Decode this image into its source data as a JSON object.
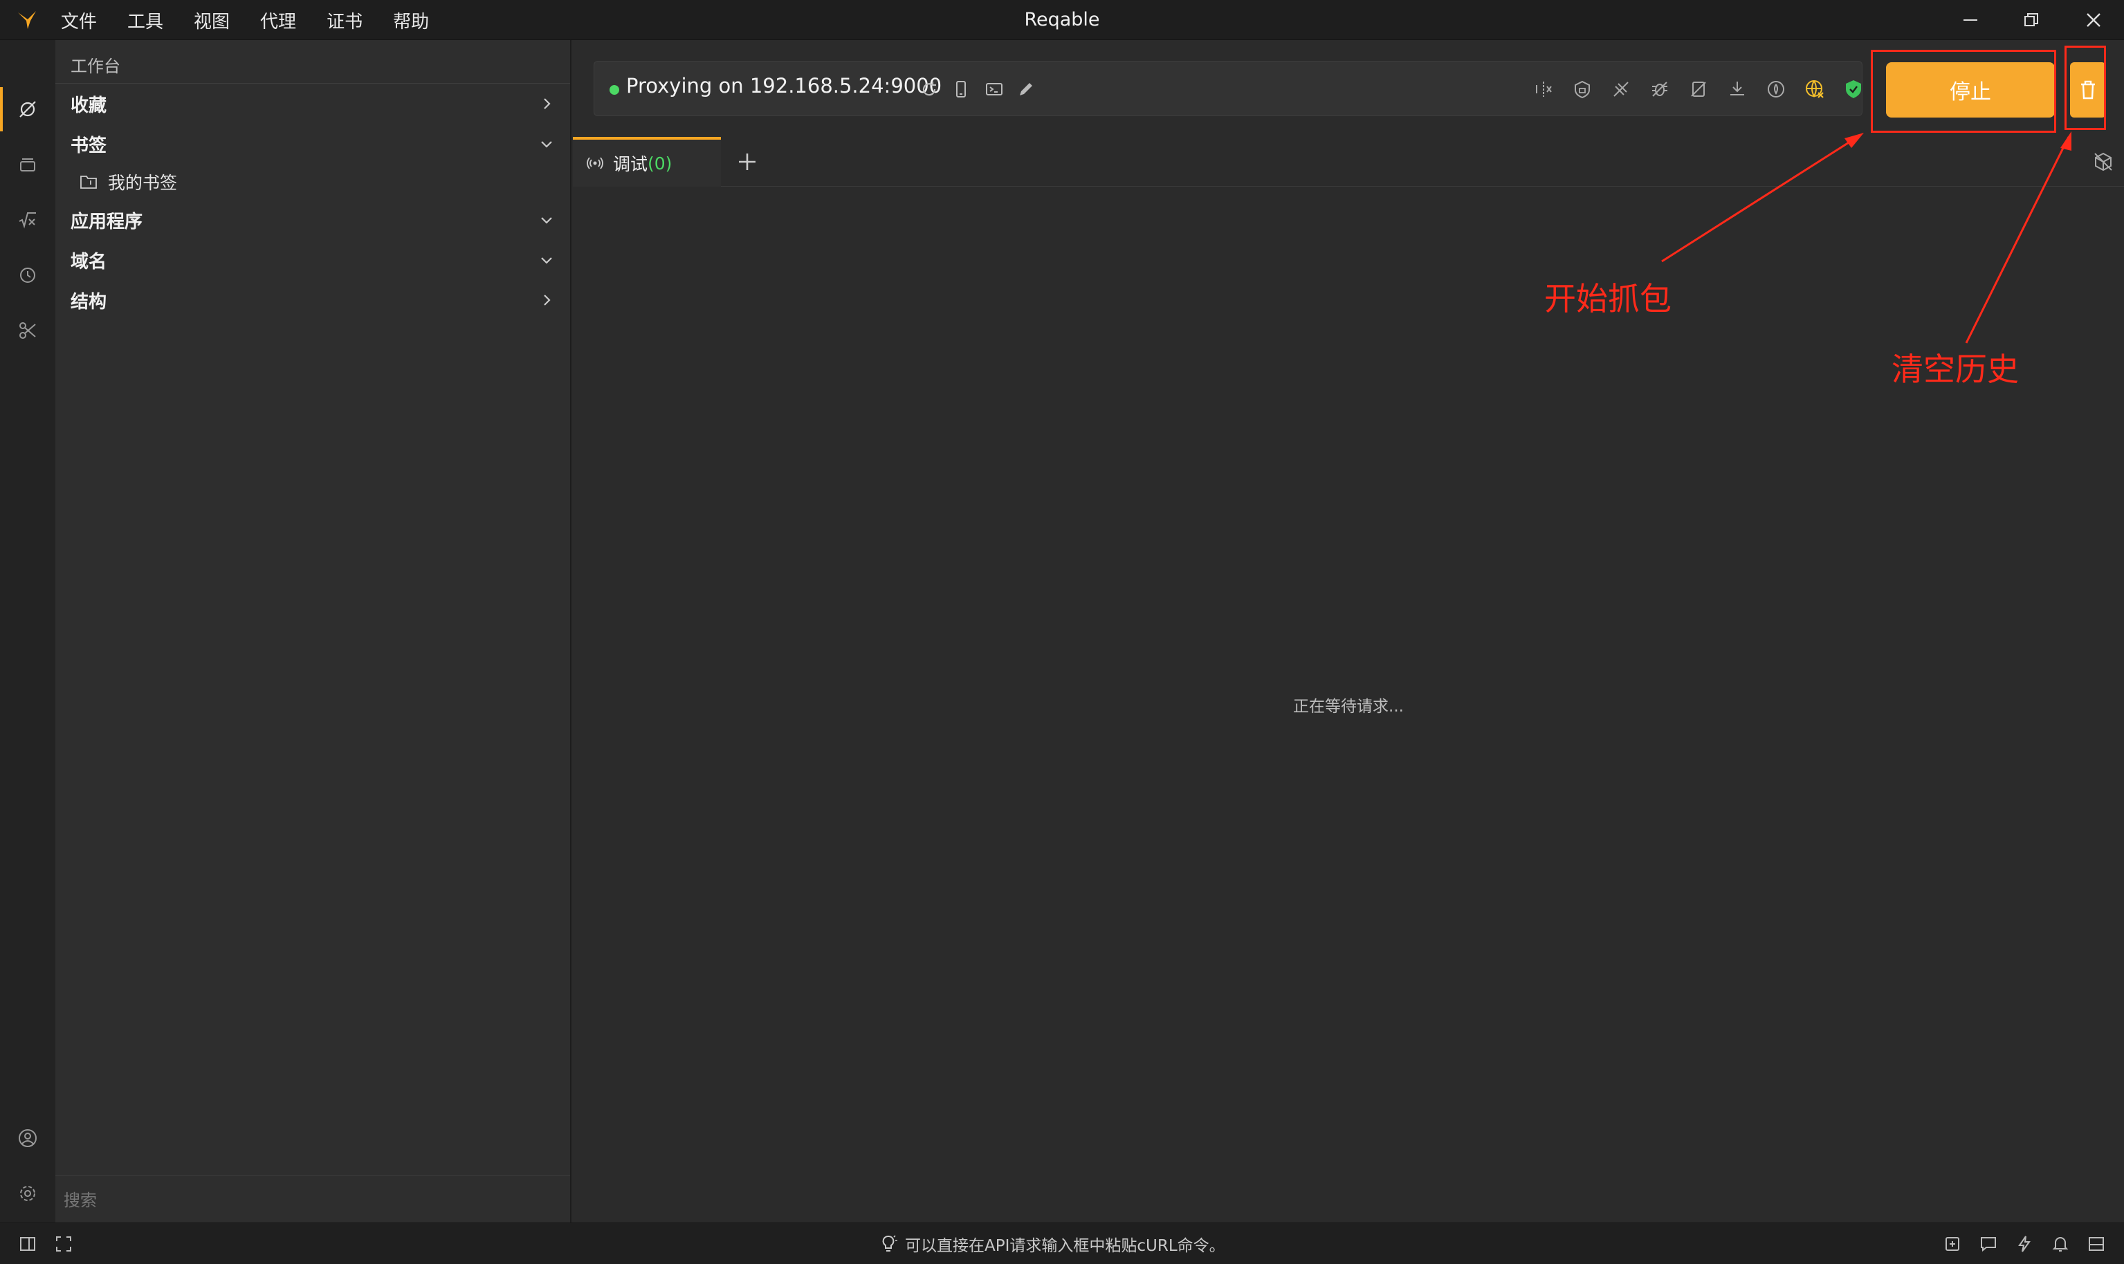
{
  "app": {
    "title": "Reqable"
  },
  "menu": [
    "文件",
    "工具",
    "视图",
    "代理",
    "证书",
    "帮助"
  ],
  "sidebar": {
    "header": "工作台",
    "sections": [
      {
        "label": "收藏",
        "state": "collapsed"
      },
      {
        "label": "书签",
        "state": "expanded",
        "children": [
          "我的书签"
        ]
      },
      {
        "label": "应用程序",
        "state": "expanded"
      },
      {
        "label": "域名",
        "state": "expanded"
      },
      {
        "label": "结构",
        "state": "collapsed"
      }
    ],
    "search_placeholder": "搜索"
  },
  "proxy": {
    "status_text": "Proxying on 192.168.5.24:9000",
    "status_color": "#4cd964",
    "stop_label": "停止",
    "accent": "#f7a92e"
  },
  "tabs": [
    {
      "label": "调试",
      "count": "(0)"
    }
  ],
  "main": {
    "waiting_text": "正在等待请求..."
  },
  "statusbar": {
    "tip": "可以直接在API请求输入框中粘贴cURL命令。"
  },
  "annotations": {
    "start_capture": "开始抓包",
    "clear_history": "清空历史",
    "color": "#ff2a1a"
  }
}
